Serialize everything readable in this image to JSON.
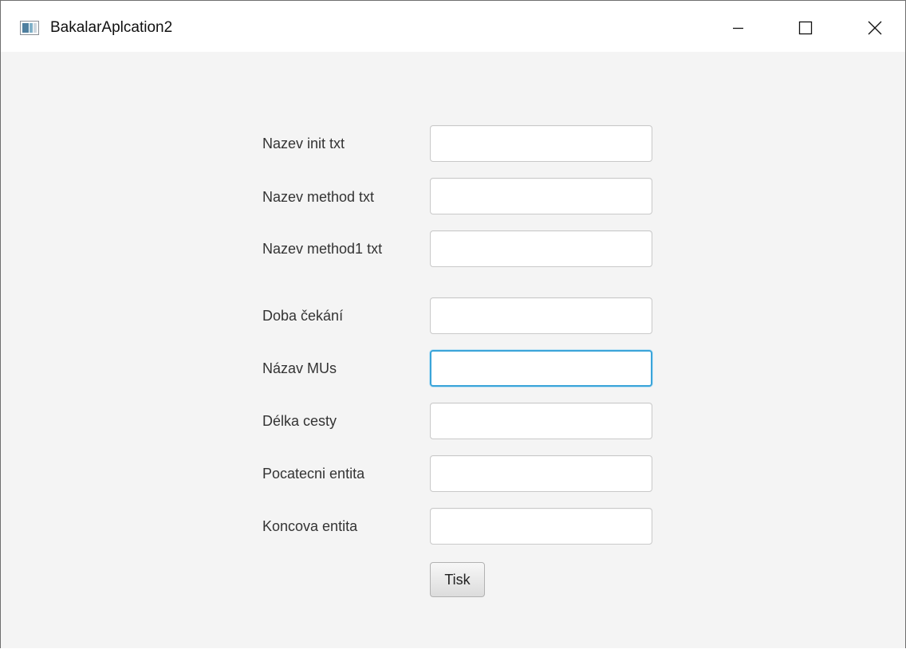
{
  "window": {
    "title": "BakalarAplcation2",
    "controls": {
      "minimize": "minimize-icon",
      "maximize": "maximize-icon",
      "close": "close-icon"
    }
  },
  "form": {
    "fields": [
      {
        "label": "Nazev init txt",
        "value": ""
      },
      {
        "label": "Nazev method txt",
        "value": ""
      },
      {
        "label": "Nazev method1 txt",
        "value": ""
      },
      {
        "label": "Doba čekání",
        "value": ""
      },
      {
        "label": "Názav MUs",
        "value": "",
        "focused": true
      },
      {
        "label": "Délka cesty",
        "value": ""
      },
      {
        "label": "Pocatecni entita",
        "value": ""
      },
      {
        "label": "Koncova entita",
        "value": ""
      }
    ],
    "submit_label": "Tisk"
  },
  "colors": {
    "focus_border": "#3aa4d9",
    "window_background": "#f4f4f4",
    "titlebar_background": "#ffffff"
  }
}
